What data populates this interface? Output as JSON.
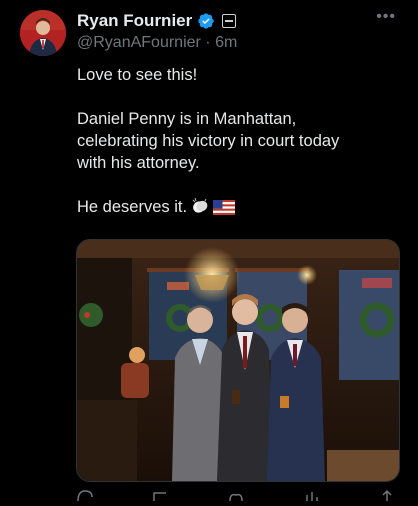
{
  "tweet": {
    "display_name": "Ryan Fournier",
    "handle": "@RyanAFournier",
    "separator": "·",
    "time_ago": "6m",
    "lines": [
      "Love to see this!",
      "",
      "Daniel Penny is in Manhattan,",
      "celebrating his victory in court today",
      "with his attorney.",
      "",
      "He deserves it."
    ],
    "emojis": [
      "clapping-hands",
      "us-flag"
    ]
  },
  "media": {
    "description_icon": "photo-image",
    "accent_colors": {
      "wood": "#5a3420",
      "wreath": "#2f5a2a",
      "light": "#f2c46a"
    }
  },
  "icons": {
    "verified": "verified-badge-icon",
    "label": "account-label-icon",
    "more": "more-options-icon"
  },
  "colors": {
    "background": "#000000",
    "text": "#e7e9ea",
    "secondary": "#71767b",
    "verified_blue": "#1d9bf0"
  }
}
